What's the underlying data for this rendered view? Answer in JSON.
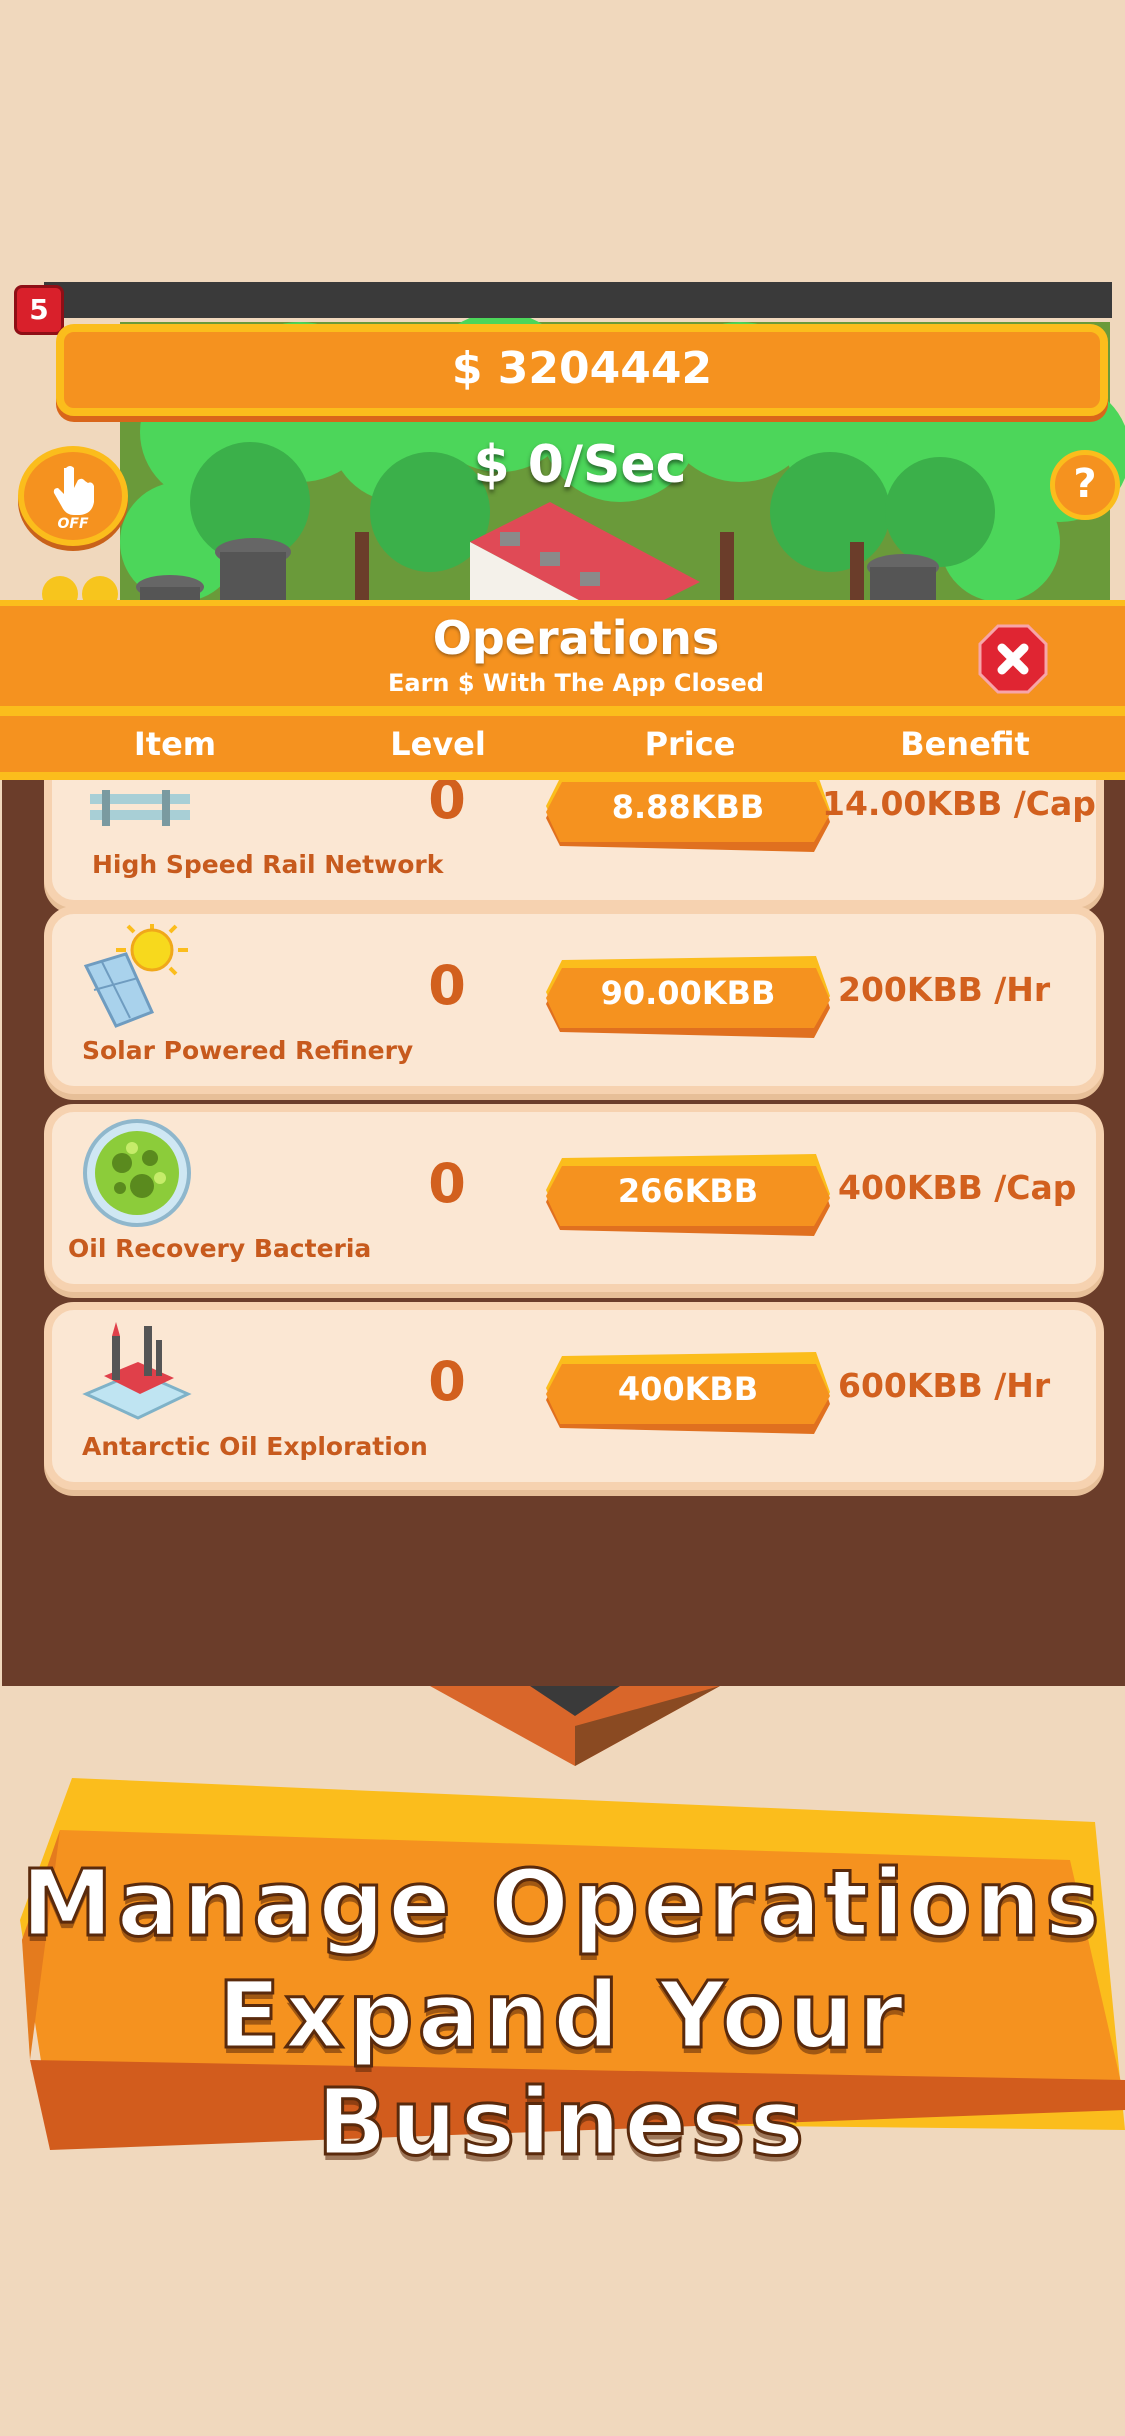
{
  "hud": {
    "level_badge": "5",
    "money": "$ 3204442",
    "rate": "$ 0/Sec",
    "auto_tap_label": "OFF",
    "help_label": "?"
  },
  "operations_panel": {
    "title": "Operations",
    "subtitle": "Earn $ With The App Closed",
    "columns": [
      "Item",
      "Level",
      "Price",
      "Benefit"
    ],
    "rows": [
      {
        "name": "High Speed Rail Network",
        "level": "0",
        "price": "8.88KBB",
        "benefit": "14.00KBB /Cap",
        "icon": "rail-icon"
      },
      {
        "name": "Solar Powered Refinery",
        "level": "0",
        "price": "90.00KBB",
        "benefit": "200KBB /Hr",
        "icon": "solar-panel-icon"
      },
      {
        "name": "Oil Recovery Bacteria",
        "level": "0",
        "price": "266KBB",
        "benefit": "400KBB /Cap",
        "icon": "bacteria-dish-icon"
      },
      {
        "name": "Antarctic Oil Exploration",
        "level": "0",
        "price": "400KBB",
        "benefit": "600KBB /Hr",
        "icon": "oil-rig-icon"
      }
    ]
  },
  "banner": {
    "line1": "Manage Operations",
    "line2": "Expand Your Business"
  },
  "colors": {
    "background": "#f0d8bd",
    "orange": "#f5921f",
    "yellow": "#fbbd1c",
    "brown": "#6b3d2a",
    "row_bg": "#fbe7d3",
    "text_orange": "#d2601e",
    "close_red": "#e02532"
  }
}
